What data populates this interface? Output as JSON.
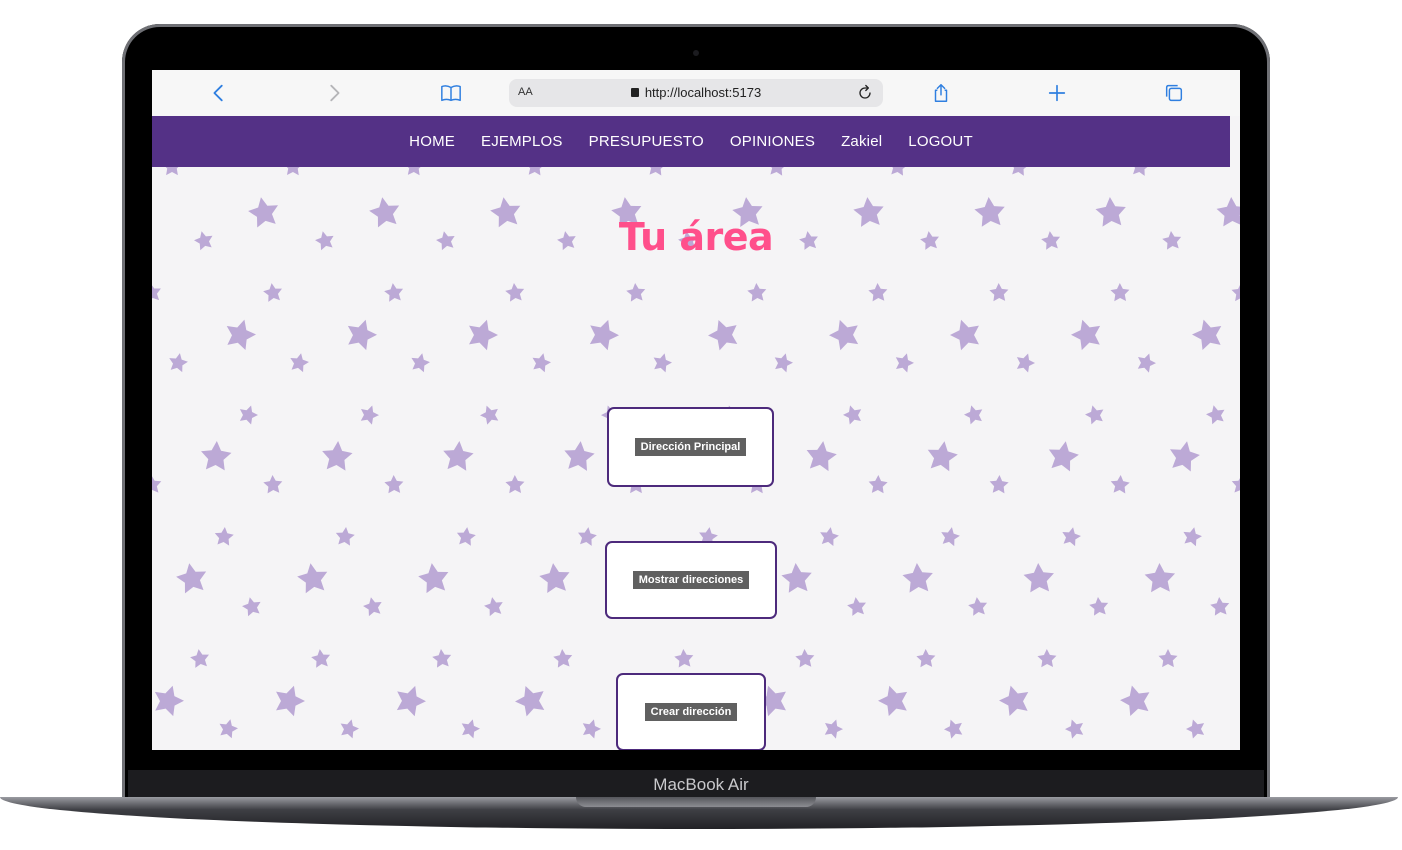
{
  "device": {
    "brand": "MacBook Air"
  },
  "browser": {
    "text_size_label": "AA",
    "url": "http://localhost:5173",
    "icons": [
      "back-icon",
      "forward-icon",
      "bookmarks-icon",
      "lock-icon",
      "reload-icon",
      "share-icon",
      "new-tab-icon",
      "tabs-icon"
    ]
  },
  "nav": {
    "items": [
      "HOME",
      "EJEMPLOS",
      "PRESUPUESTO",
      "OPINIONES",
      "Zakiel",
      "LOGOUT"
    ]
  },
  "page": {
    "title": "Tu área",
    "buttons": [
      "Dirección Principal",
      "Mostrar direcciones",
      "Crear dirección"
    ]
  },
  "colors": {
    "nav_bg": "#543186",
    "title": "#ff4f8b",
    "card_border": "#4d2a7c",
    "button_bg": "#606060",
    "star": "#bca9d6",
    "page_bg": "#f5f4f6"
  }
}
